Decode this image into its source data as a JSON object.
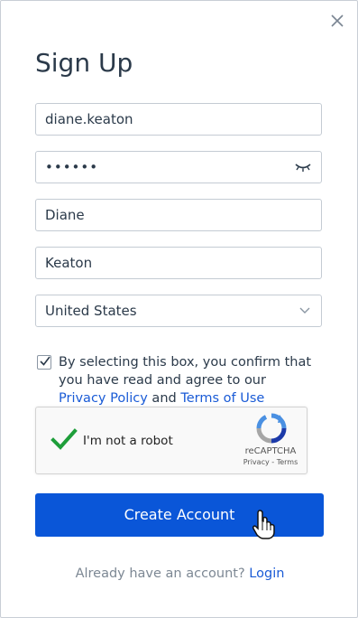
{
  "dialog": {
    "title": "Sign Up",
    "close_icon": "close-icon"
  },
  "form": {
    "username": {
      "value": "diane.keaton"
    },
    "password": {
      "masked_value": "••••••",
      "toggle_icon": "eye-closed-icon"
    },
    "first_name": {
      "value": "Diane"
    },
    "last_name": {
      "value": "Keaton"
    },
    "country": {
      "selected": "United States",
      "icon": "chevron-down-icon"
    }
  },
  "consent": {
    "checked": true,
    "text_before": "By selecting this box, you confirm that you have read and agree to our ",
    "privacy_link": "Privacy Policy",
    "and_text": " and ",
    "terms_link": "Terms of Use"
  },
  "captcha": {
    "checked": true,
    "label": "I'm not a robot",
    "brand": "reCAPTCHA",
    "privacy": "Privacy",
    "separator": " - ",
    "terms": "Terms"
  },
  "submit": {
    "label": "Create Account"
  },
  "footer": {
    "prompt": "Already have an account? ",
    "login_link": "Login"
  },
  "colors": {
    "primary": "#0a56d8",
    "link": "#1a5bd6",
    "captcha_check": "#1e9e3a"
  }
}
